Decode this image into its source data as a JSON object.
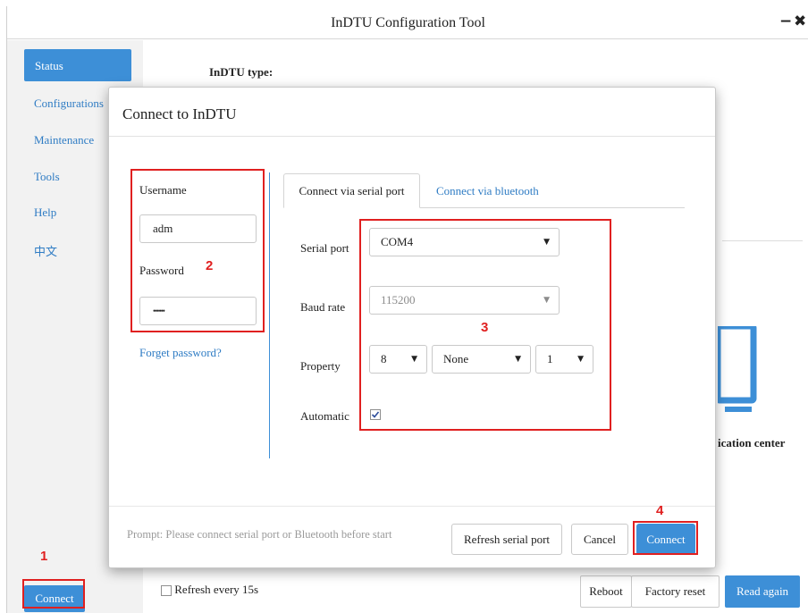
{
  "window": {
    "title": "InDTU Configuration Tool",
    "minimize_glyph": "−",
    "close_glyph": "✖"
  },
  "sidebar": {
    "items": [
      {
        "label": "Status",
        "active": true
      },
      {
        "label": "Configurations"
      },
      {
        "label": "Maintenance"
      },
      {
        "label": "Tools"
      },
      {
        "label": "Help"
      },
      {
        "label": "中文"
      }
    ],
    "connect_label": "Connect"
  },
  "background": {
    "indtu_type_label": "InDTU type:",
    "partial_label": "ication center",
    "refresh_checkbox_label": "Refresh every 15s",
    "refresh_checked": false,
    "reboot_label": "Reboot",
    "factory_reset_label": "Factory reset",
    "read_again_label": "Read again"
  },
  "dialog": {
    "title": "Connect to InDTU",
    "username_label": "Username",
    "username_value": "adm",
    "password_label": "Password",
    "password_value": "••••••",
    "forget_password_link": "Forget password?",
    "tabs": [
      {
        "label": "Connect via serial port",
        "active": true
      },
      {
        "label": "Connect via bluetooth",
        "active": false
      }
    ],
    "serial_port_label": "Serial port",
    "serial_port_value": "COM4",
    "baud_rate_label": "Baud rate",
    "baud_rate_value": "115200",
    "property_label": "Property",
    "property_data_bits": "8",
    "property_parity": "None",
    "property_stop_bits": "1",
    "automatic_label": "Automatic",
    "automatic_checked": true,
    "prompt_text": "Prompt: Please connect serial port or Bluetooth before start",
    "refresh_serial_port_label": "Refresh serial port",
    "cancel_label": "Cancel",
    "connect_label": "Connect"
  },
  "annotations": {
    "step1": "1",
    "step2": "2",
    "step3": "3",
    "step4": "4",
    "color": "#e02020"
  },
  "colors": {
    "accent": "#3d8fd7",
    "link": "#2f7cc4",
    "sidebar_bg": "#f2f2f2"
  }
}
